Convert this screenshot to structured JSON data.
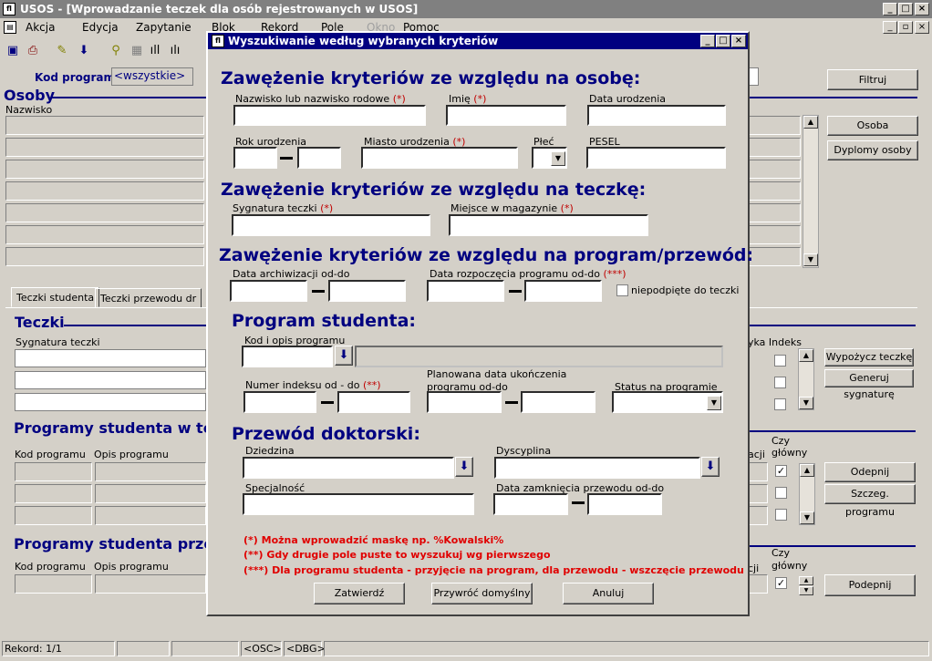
{
  "app": {
    "title": "USOS - [Wprowadzanie teczek dla osób rejestrowanych w USOS]",
    "icon_label": "ﬂ"
  },
  "menu": [
    "Akcja",
    "Edycja",
    "Zapytanie",
    "Blok",
    "Rekord",
    "Pole",
    "Okno",
    "Pomoc"
  ],
  "bg": {
    "kod_programu_label": "Kod programu",
    "kod_programu_value": "<wszystkie>",
    "filtruj": "Filtruj",
    "osoby_title": "Osoby",
    "nazwisko_col": "Nazwisko",
    "osoba_btn": "Osoba",
    "dyplomy_btn": "Dyplomy osoby",
    "tab_teczki_studenta": "Teczki studenta",
    "tab_teczki_przewodu": "Teczki przewodu dr",
    "teczki_title": "Teczki",
    "sygnatura_teczki": "Sygnatura teczki",
    "programy_w_teczce_title": "Programy studenta w teczce",
    "kod_programu_col": "Kod programu",
    "opis_programu_col": "Opis programu",
    "programy_przekaz_title": "Programy studenta przekaz",
    "kod_programu_col2": "Kod programu",
    "opis_programu_col2": "Opis programu",
    "yka_indeks": "yka Indeks",
    "wypozycz_btn": "Wypożycz teczkę",
    "generuj_btn": "Generuj sygnaturę",
    "acji": "acji",
    "czy": "Czy",
    "glowny": "główny",
    "acji2": "cji",
    "czy2": "Czy",
    "glowny2": "główny",
    "odepnij_btn": "Odepnij",
    "szczeg_btn": "Szczeg. programu",
    "podepnij_btn": "Podepnij"
  },
  "status": {
    "rekord": "Rekord: 1/1",
    "osc": "<OSC>",
    "dbg": "<DBG>"
  },
  "dialog": {
    "title": "Wyszukiwanie według wybranych kryteriów",
    "sec_osoba": "Zawężenie kryteriów ze względu na osobę:",
    "nazwisko_label": "Nazwisko lub nazwisko rodowe",
    "imie_label": "Imię",
    "data_ur_label": "Data urodzenia",
    "rok_ur_label": "Rok urodzenia",
    "miasto_label": "Miasto urodzenia",
    "plec_label": "Płeć",
    "pesel_label": "PESEL",
    "sec_teczka": "Zawężenie kryteriów ze względu na teczkę:",
    "sygnatura_label": "Sygnatura teczki",
    "miejsce_label": "Miejsce w magazynie",
    "sec_program": "Zawężenie kryteriów ze względu na program/przewód:",
    "data_arch_label": "Data archiwizacji od-do",
    "data_rozp_label": "Data rozpoczęcia programu od-do",
    "niepodpiete_label": "niepodpięte do teczki",
    "sec_program_studenta": "Program studenta:",
    "kod_opis_label": "Kod i opis programu",
    "numer_indeksu_label": "Numer indeksu od - do",
    "planowana_label_1": "Planowana data ukończenia",
    "planowana_label_2": "programu od-do",
    "status_label": "Status na programie",
    "sec_przewod": "Przewód doktorski:",
    "dziedzina_label": "Dziedzina",
    "dyscyplina_label": "Dyscyplina",
    "specjalnosc_label": "Specjalność",
    "data_zamkniecia_label": "Data zamknięcia przewodu od-do",
    "req1": "(*)",
    "req2": "(**)",
    "req3": "(***)",
    "note1": "(*) Można wprowadzić maskę np. %Kowalski%",
    "note2": "(**) Gdy drugie pole puste to wyszukuj wg pierwszego",
    "note3": "(***) Dla programu studenta - przyjęcie na program, dla przewodu - wszczęcie przewodu",
    "zatwierdz": "Zatwierdź",
    "przywroc": "Przywróć domyślny",
    "anuluj": "Anuluj"
  }
}
